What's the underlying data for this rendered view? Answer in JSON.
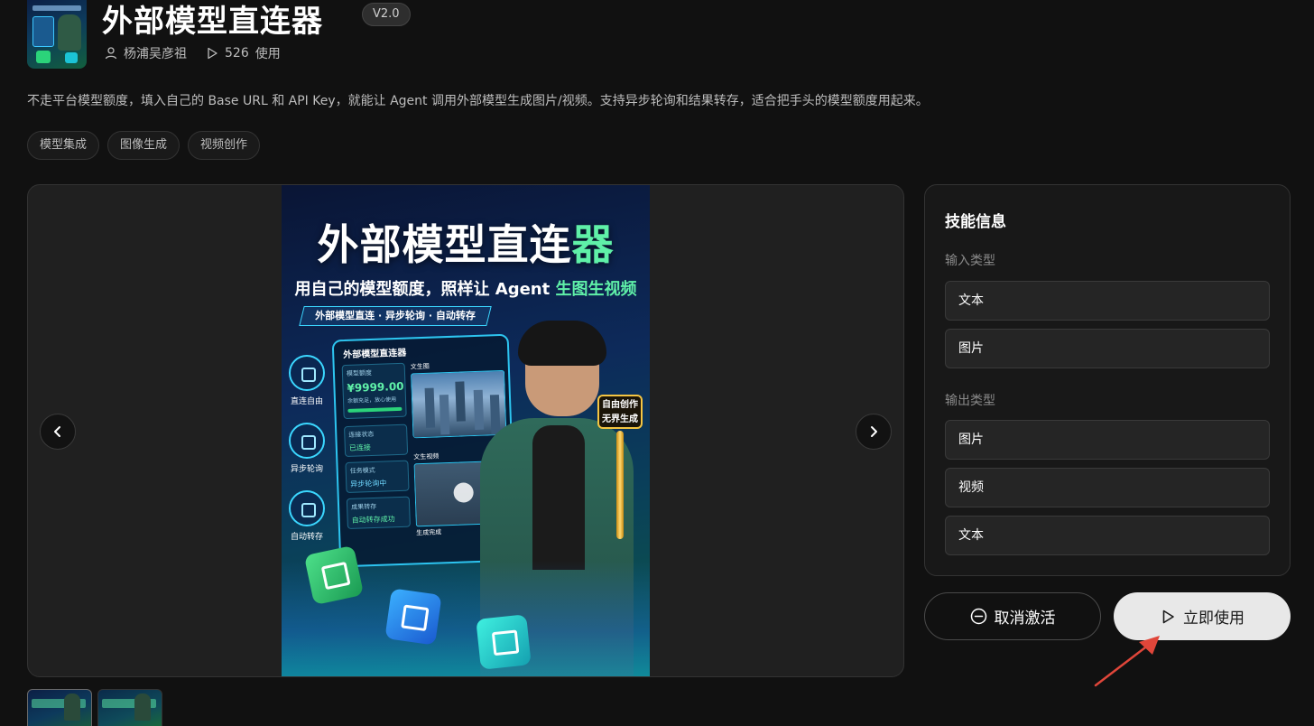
{
  "header": {
    "title": "外部模型直连器",
    "version": "V2.0",
    "author": "杨浦吴彦祖",
    "usage_count": "526",
    "usage_label": "使用"
  },
  "description": "不走平台模型额度，填入自己的 Base URL 和 API Key，就能让 Agent 调用外部模型生成图片/视频。支持异步轮询和结果转存，适合把手头的模型额度用起来。",
  "tags": [
    "模型集成",
    "图像生成",
    "视频创作"
  ],
  "poster": {
    "title_main": "外部模型直连",
    "title_accent": "器",
    "subtitle_main": "用自己的模型额度，照样让 Agent ",
    "subtitle_accent": "生图生视频",
    "ribbon": "外部模型直连 · 异步轮询 · 自动转存",
    "left_icons": [
      "直连自由",
      "异步轮询",
      "自动转存"
    ],
    "panel_title": "外部模型直连器",
    "card_quota_label": "模型额度",
    "card_quota_value": "¥9999.00",
    "card_quota_note": "余额充足，放心使用",
    "card_status_label": "连接状态",
    "card_status_value": "已连接",
    "card_mode_label": "任务模式",
    "card_mode_value": "异步轮询中",
    "card_save_label": "成果转存",
    "card_save_value": "自动转存成功",
    "img_caption_1": "文生图",
    "img_caption_2": "文生视频",
    "img_caption_3": "生成完成",
    "key_text": "自由创作 无界生成"
  },
  "skill_info": {
    "title": "技能信息",
    "input_label": "输入类型",
    "input_types": [
      "文本",
      "图片"
    ],
    "output_label": "输出类型",
    "output_types": [
      "图片",
      "视频",
      "文本"
    ]
  },
  "actions": {
    "deactivate": "取消激活",
    "use_now": "立即使用"
  },
  "colors": {
    "background": "#111111",
    "panel": "#181818",
    "primary_button": "#e8e8e8",
    "annotation": "#e0463a",
    "poster_accent": "#5ff0a8"
  }
}
